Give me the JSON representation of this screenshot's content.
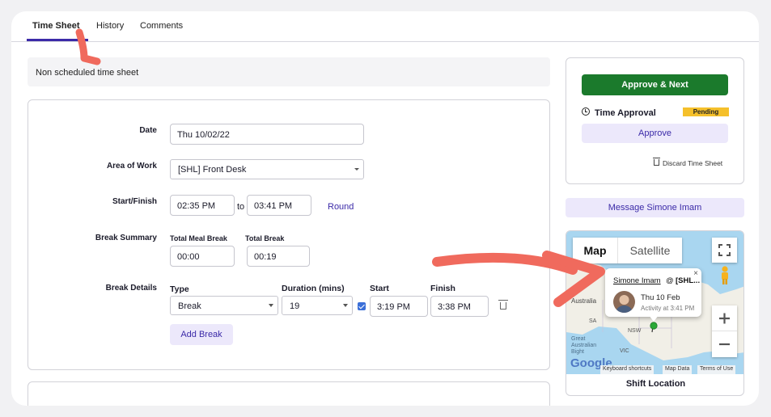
{
  "tabs": [
    {
      "label": "Time Sheet",
      "active": true
    },
    {
      "label": "History",
      "active": false
    },
    {
      "label": "Comments",
      "active": false
    }
  ],
  "banner": {
    "text": "Non scheduled time sheet"
  },
  "form": {
    "date": {
      "label": "Date",
      "value": "Thu 10/02/22"
    },
    "area_of_work": {
      "label": "Area of Work",
      "value": "[SHL] Front Desk"
    },
    "start_finish": {
      "label": "Start/Finish",
      "start": "02:35 PM",
      "to": "to",
      "finish": "03:41 PM",
      "round_label": "Round"
    },
    "break_summary": {
      "label": "Break Summary",
      "total_meal_label": "Total Meal Break",
      "total_meal_value": "00:00",
      "total_break_label": "Total Break",
      "total_break_value": "00:19"
    },
    "break_details": {
      "label": "Break Details",
      "headers": {
        "type": "Type",
        "duration": "Duration (mins)",
        "start": "Start",
        "finish": "Finish"
      },
      "row": {
        "type": "Break",
        "duration": "19",
        "paid_checked": true,
        "start": "3:19 PM",
        "finish": "3:38 PM"
      },
      "add_label": "Add Break"
    }
  },
  "sidebar": {
    "approve_next_label": "Approve & Next",
    "time_approval_label": "Time Approval",
    "status_badge": "Pending",
    "approve_label": "Approve",
    "discard_label": "Discard Time Sheet",
    "message_label": "Message Simone Imam"
  },
  "map": {
    "type_map": "Map",
    "type_satellite": "Satellite",
    "popup_name": "Simone Imam",
    "popup_at": "@",
    "popup_location": "[SHL...",
    "popup_date": "Thu 10 Feb",
    "popup_activity": "Activity at 3:41 PM",
    "labels": {
      "australia": "Australia",
      "sa": "SA",
      "nsw": "NSW",
      "vic": "VIC",
      "bight_1": "Great",
      "bight_2": "Australian",
      "bight_3": "Bight"
    },
    "google": "Google",
    "attrib_shortcuts": "Keyboard shortcuts",
    "attrib_data": "Map Data",
    "attrib_terms": "Terms of Use",
    "footer": "Shift Location"
  },
  "colors": {
    "accent": "#3b2aa8",
    "approve_green": "#1b7a2c",
    "pending_badge": "#f5c02b",
    "annotation_arrow": "#f06a5d",
    "map_water": "#a9d6f0",
    "map_land": "#f1efe7"
  }
}
